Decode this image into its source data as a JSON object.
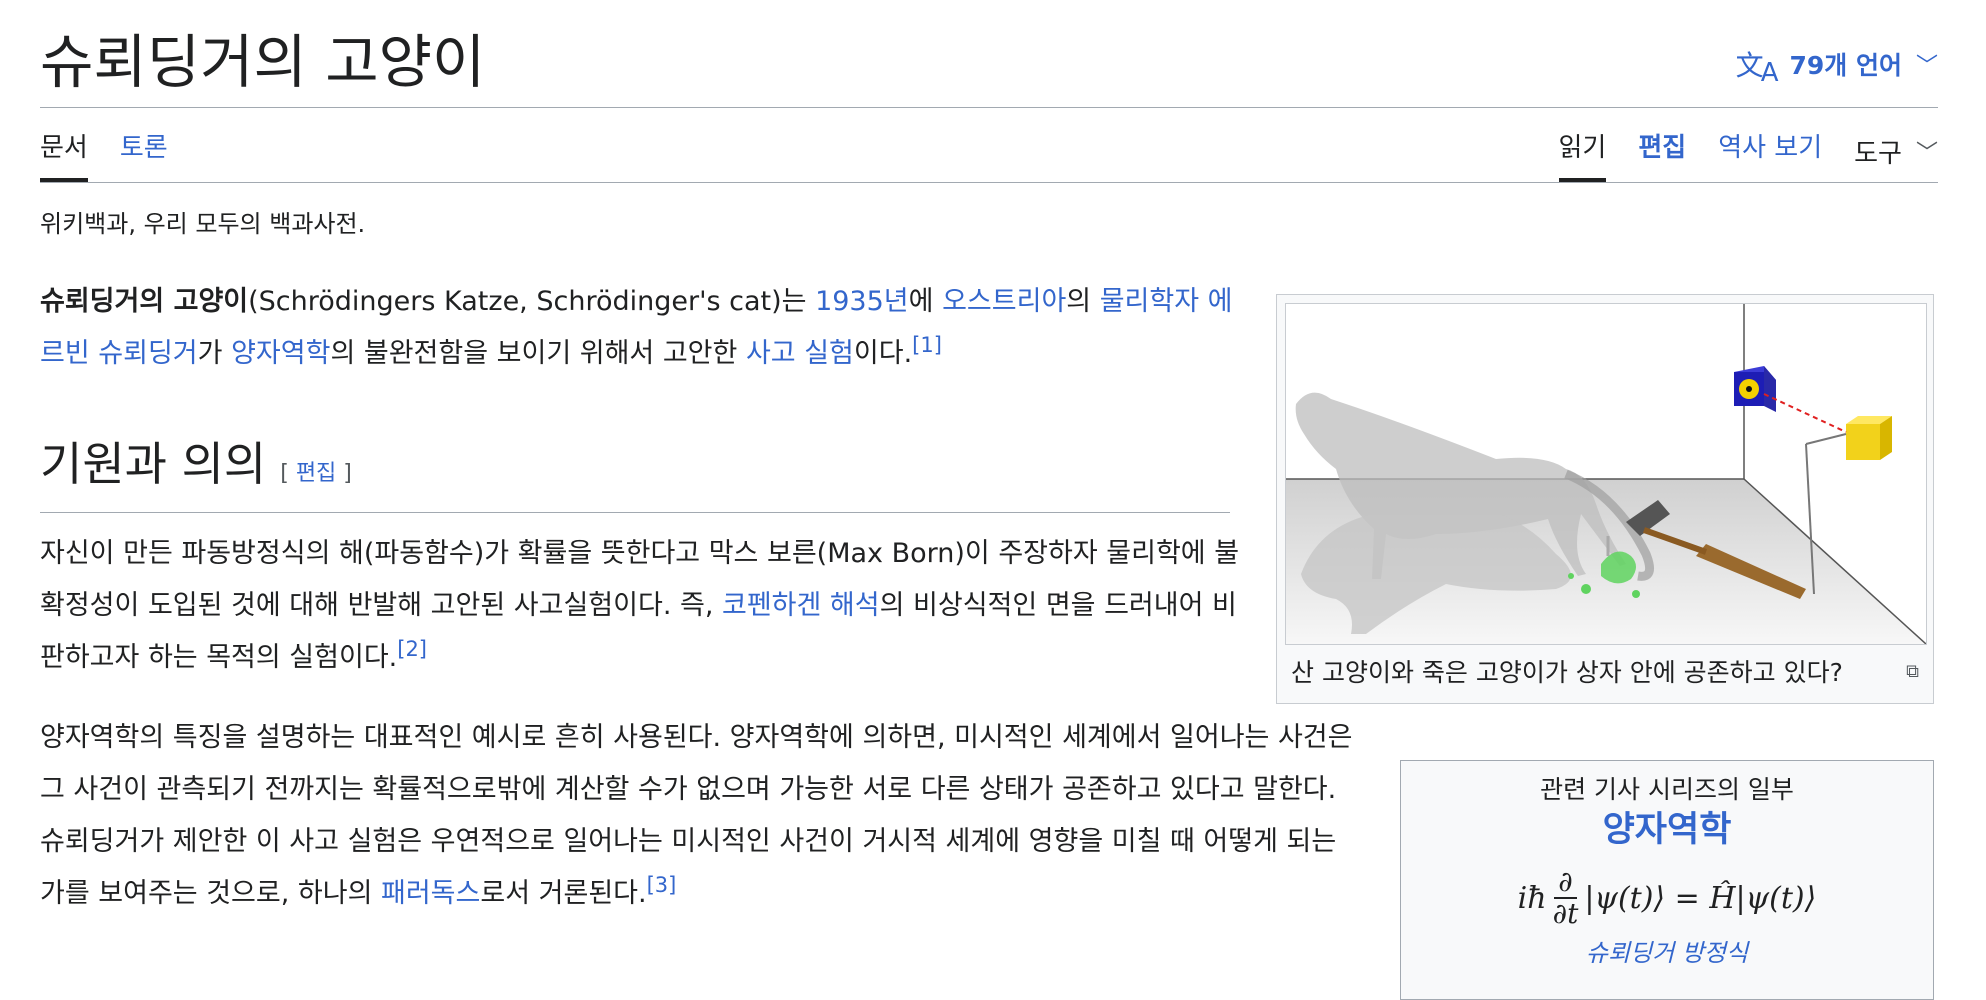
{
  "page": {
    "title": "슈뢰딩거의 고양이",
    "languages_label": "79개 언어",
    "tagline": "위키백과, 우리 모두의 백과사전."
  },
  "tabs_left": [
    "문서",
    "토론"
  ],
  "tabs_right": {
    "read": "읽기",
    "edit": "편집",
    "history": "역사 보기",
    "tools": "도구"
  },
  "icons": {
    "language": "translate-icon",
    "dropdown": "chevron-down-icon",
    "magnify": "expand-icon"
  },
  "colors": {
    "link": "#3366cc",
    "text": "#202122",
    "border": "#a2a9b1"
  },
  "intro": {
    "bold": "슈뢰딩거의 고양이",
    "t1": "(Schrödingers Katze, Schrödinger's cat)는 ",
    "link_year": "1935년",
    "t2": "에 ",
    "link_austria": "오스트리아",
    "t3": "의 ",
    "link_physicist": "물리학자 에르빈 슈뢰딩거",
    "t4": "가 ",
    "link_qm": "양자역학",
    "t5": "의 불완전함을 보이기 위해서 고안한 ",
    "link_thought": "사고 실험",
    "t6": "이다.",
    "ref": "[1]"
  },
  "section": {
    "heading": "기원과 의의",
    "edit_open": "[ ",
    "edit_label": "편집",
    "edit_close": " ]"
  },
  "para2": {
    "t1": "자신이 만든 파동방정식의 해(파동함수)가 확률을 뜻한다고 막스 보른(Max Born)이 주장하자 물리학에 불확정성이 도입된 것에 대해 반발해 고안된 사고실험이다. 즉, ",
    "link": "코펜하겐 해석",
    "t2": "의 비상식적인 면을 드러내어 비판하고자 하는 목적의 실험이다.",
    "ref": "[2]"
  },
  "para3": {
    "t1": "양자역학의 특징을 설명하는 대표적인 예시로 흔히 사용된다. 양자역학에 의하면, 미시적인 세계에서 일어나는 사건은 그 사건이 관측되기 전까지는 확률적으로밖에 계산할 수가 없으며 가능한 서로 다른 상태가 공존하고 있다고 말한다. 슈뢰딩거가 제안한 이 사고 실험은 우연적으로 일어나는 미시적인 사건이 거시적 세계에 영향을 미칠 때 어떻게 되는가를 보여주는 것으로, 하나의 ",
    "link": "패러독스",
    "t2": "로서 거론된다.",
    "ref": "[3]"
  },
  "figure": {
    "caption": "산 고양이와 죽은 고양이가 상자 안에 공존하고 있다?"
  },
  "infobox": {
    "subtitle": "관련 기사 시리즈의 일부",
    "title": "양자역학",
    "eq_lhs": "iħ",
    "eq_num": "∂",
    "eq_den": "∂t",
    "eq_rhs": "|ψ(t)⟩ = Ĥ|ψ(t)⟩",
    "link": "슈뢰딩거 방정식"
  }
}
